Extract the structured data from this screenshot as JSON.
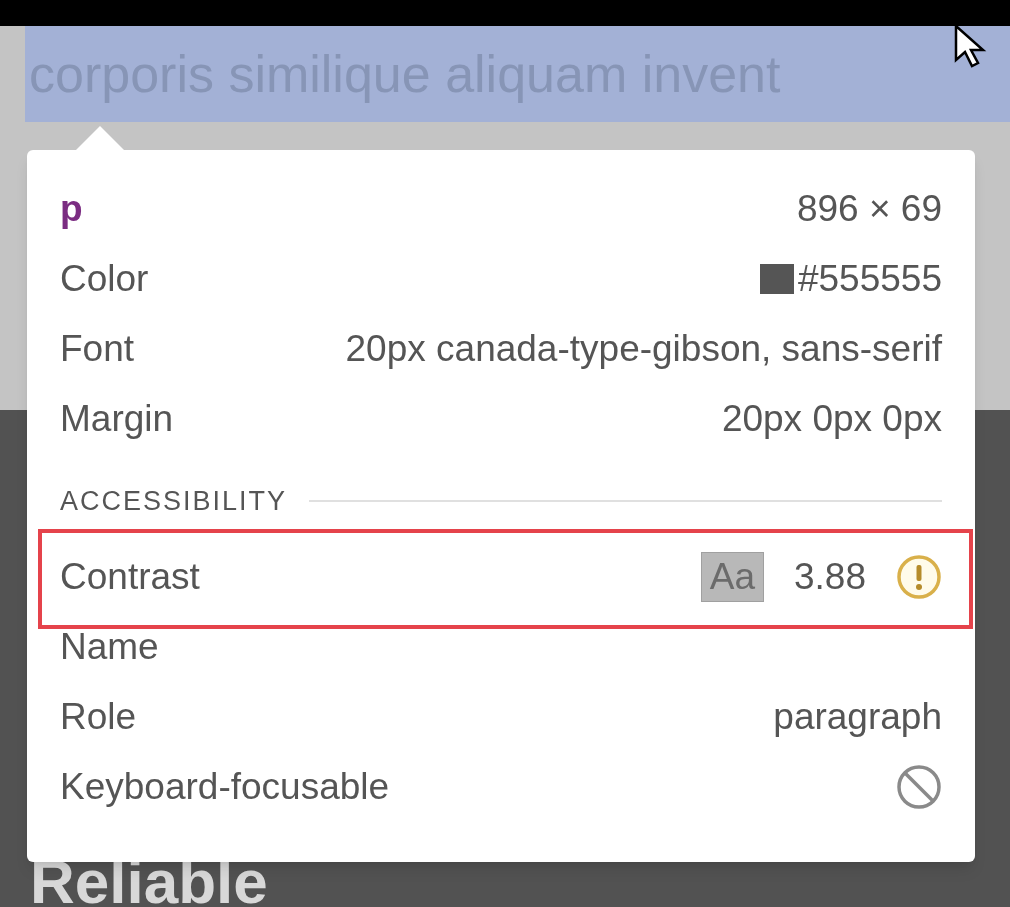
{
  "page": {
    "selected_text": "corporis similique aliquam invent",
    "heading": "Reliable"
  },
  "tooltip": {
    "tag": "p",
    "size": "896 × 69",
    "rows": [
      {
        "kind": "swatch",
        "label": "Color",
        "value": "#555555",
        "color": "#555555"
      },
      {
        "kind": "text",
        "label": "Font",
        "value": "20px canada-type-gibson, sans-serif"
      },
      {
        "kind": "text",
        "label": "Margin",
        "value": "20px 0px 0px"
      }
    ],
    "section": "ACCESSIBILITY",
    "a11y_rows": [
      {
        "kind": "contrast",
        "label": "Contrast",
        "sample": "Aa",
        "value": "3.88",
        "highlighted": true
      },
      {
        "kind": "text",
        "label": "Name"
      },
      {
        "kind": "text",
        "label": "Role",
        "value": "paragraph"
      },
      {
        "kind": "blocked",
        "label": "Keyboard-focusable"
      }
    ]
  }
}
